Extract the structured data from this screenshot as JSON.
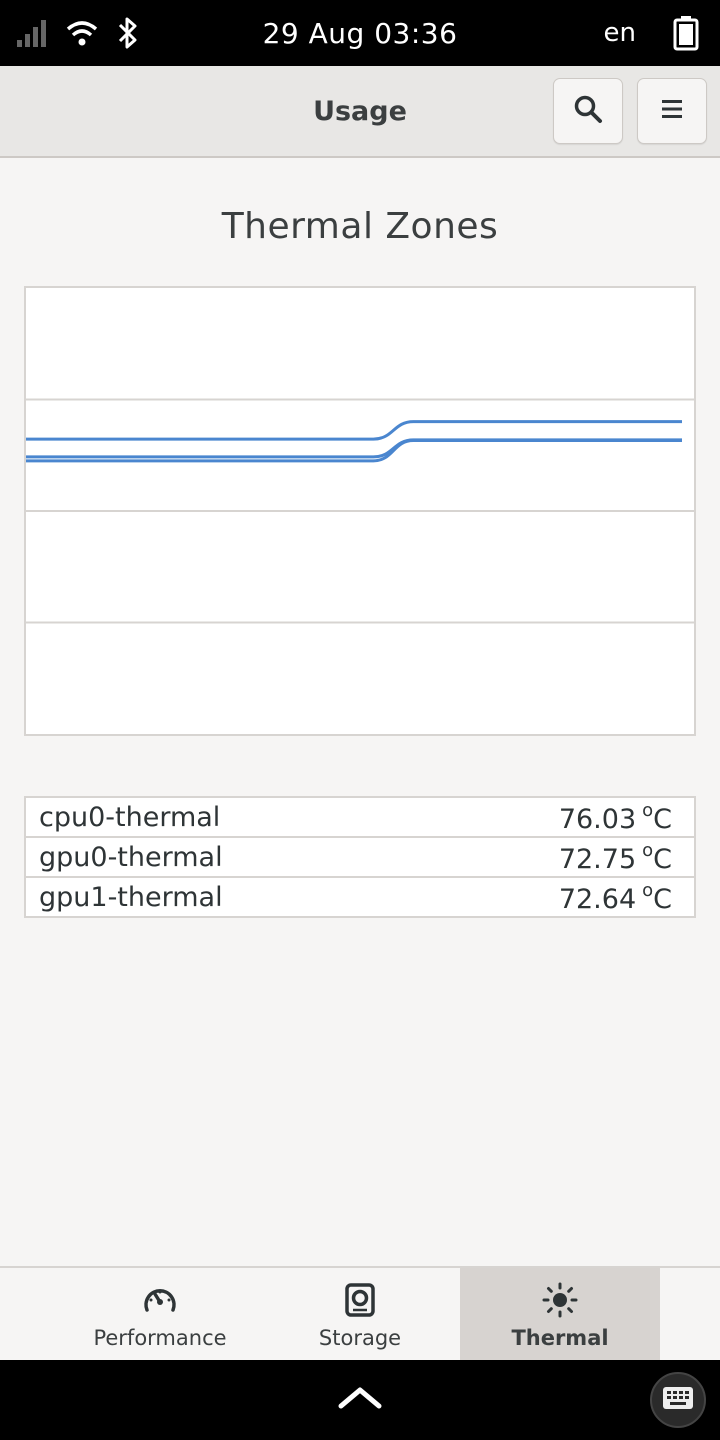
{
  "status_bar": {
    "datetime": "29 Aug  03:36",
    "language": "en",
    "icons": [
      "signal-icon",
      "wifi-icon",
      "bluetooth-icon",
      "battery-icon"
    ]
  },
  "header": {
    "title": "Usage",
    "search_icon": "search-icon",
    "menu_icon": "menu-icon"
  },
  "thermal": {
    "chart_title": "Thermal Zones",
    "zones": [
      {
        "name": "cpu0-thermal",
        "value": "76.03",
        "unit": "C"
      },
      {
        "name": "gpu0-thermal",
        "value": "72.75",
        "unit": "C"
      },
      {
        "name": "gpu1-thermal",
        "value": "72.64",
        "unit": "C"
      }
    ]
  },
  "chart_data": {
    "type": "line",
    "title": "Thermal Zones",
    "line_color": "#4a86cf",
    "series": [
      {
        "values_start": 72.9,
        "values_end": 76.03
      },
      {
        "values_start": 69.7,
        "values_end": 72.75
      },
      {
        "values_start": 69.0,
        "values_end": 72.64
      }
    ],
    "transition_fraction": 0.55,
    "ylim": [
      20,
      100
    ],
    "grid": true,
    "legend": "none"
  },
  "bottom_nav": {
    "tabs": [
      {
        "label": "Performance",
        "icon": "speedometer-icon",
        "active": false
      },
      {
        "label": "Storage",
        "icon": "disk-icon",
        "active": false
      },
      {
        "label": "Thermal",
        "icon": "sun-icon",
        "active": true
      }
    ]
  },
  "home_bar": {
    "home_icon": "chevron-up-icon",
    "keyboard_icon": "keyboard-icon"
  },
  "colors": {
    "accent_line": "#4a86cf",
    "header_bg": "#e8e7e5",
    "active_tab_bg": "#d7d3d0"
  }
}
